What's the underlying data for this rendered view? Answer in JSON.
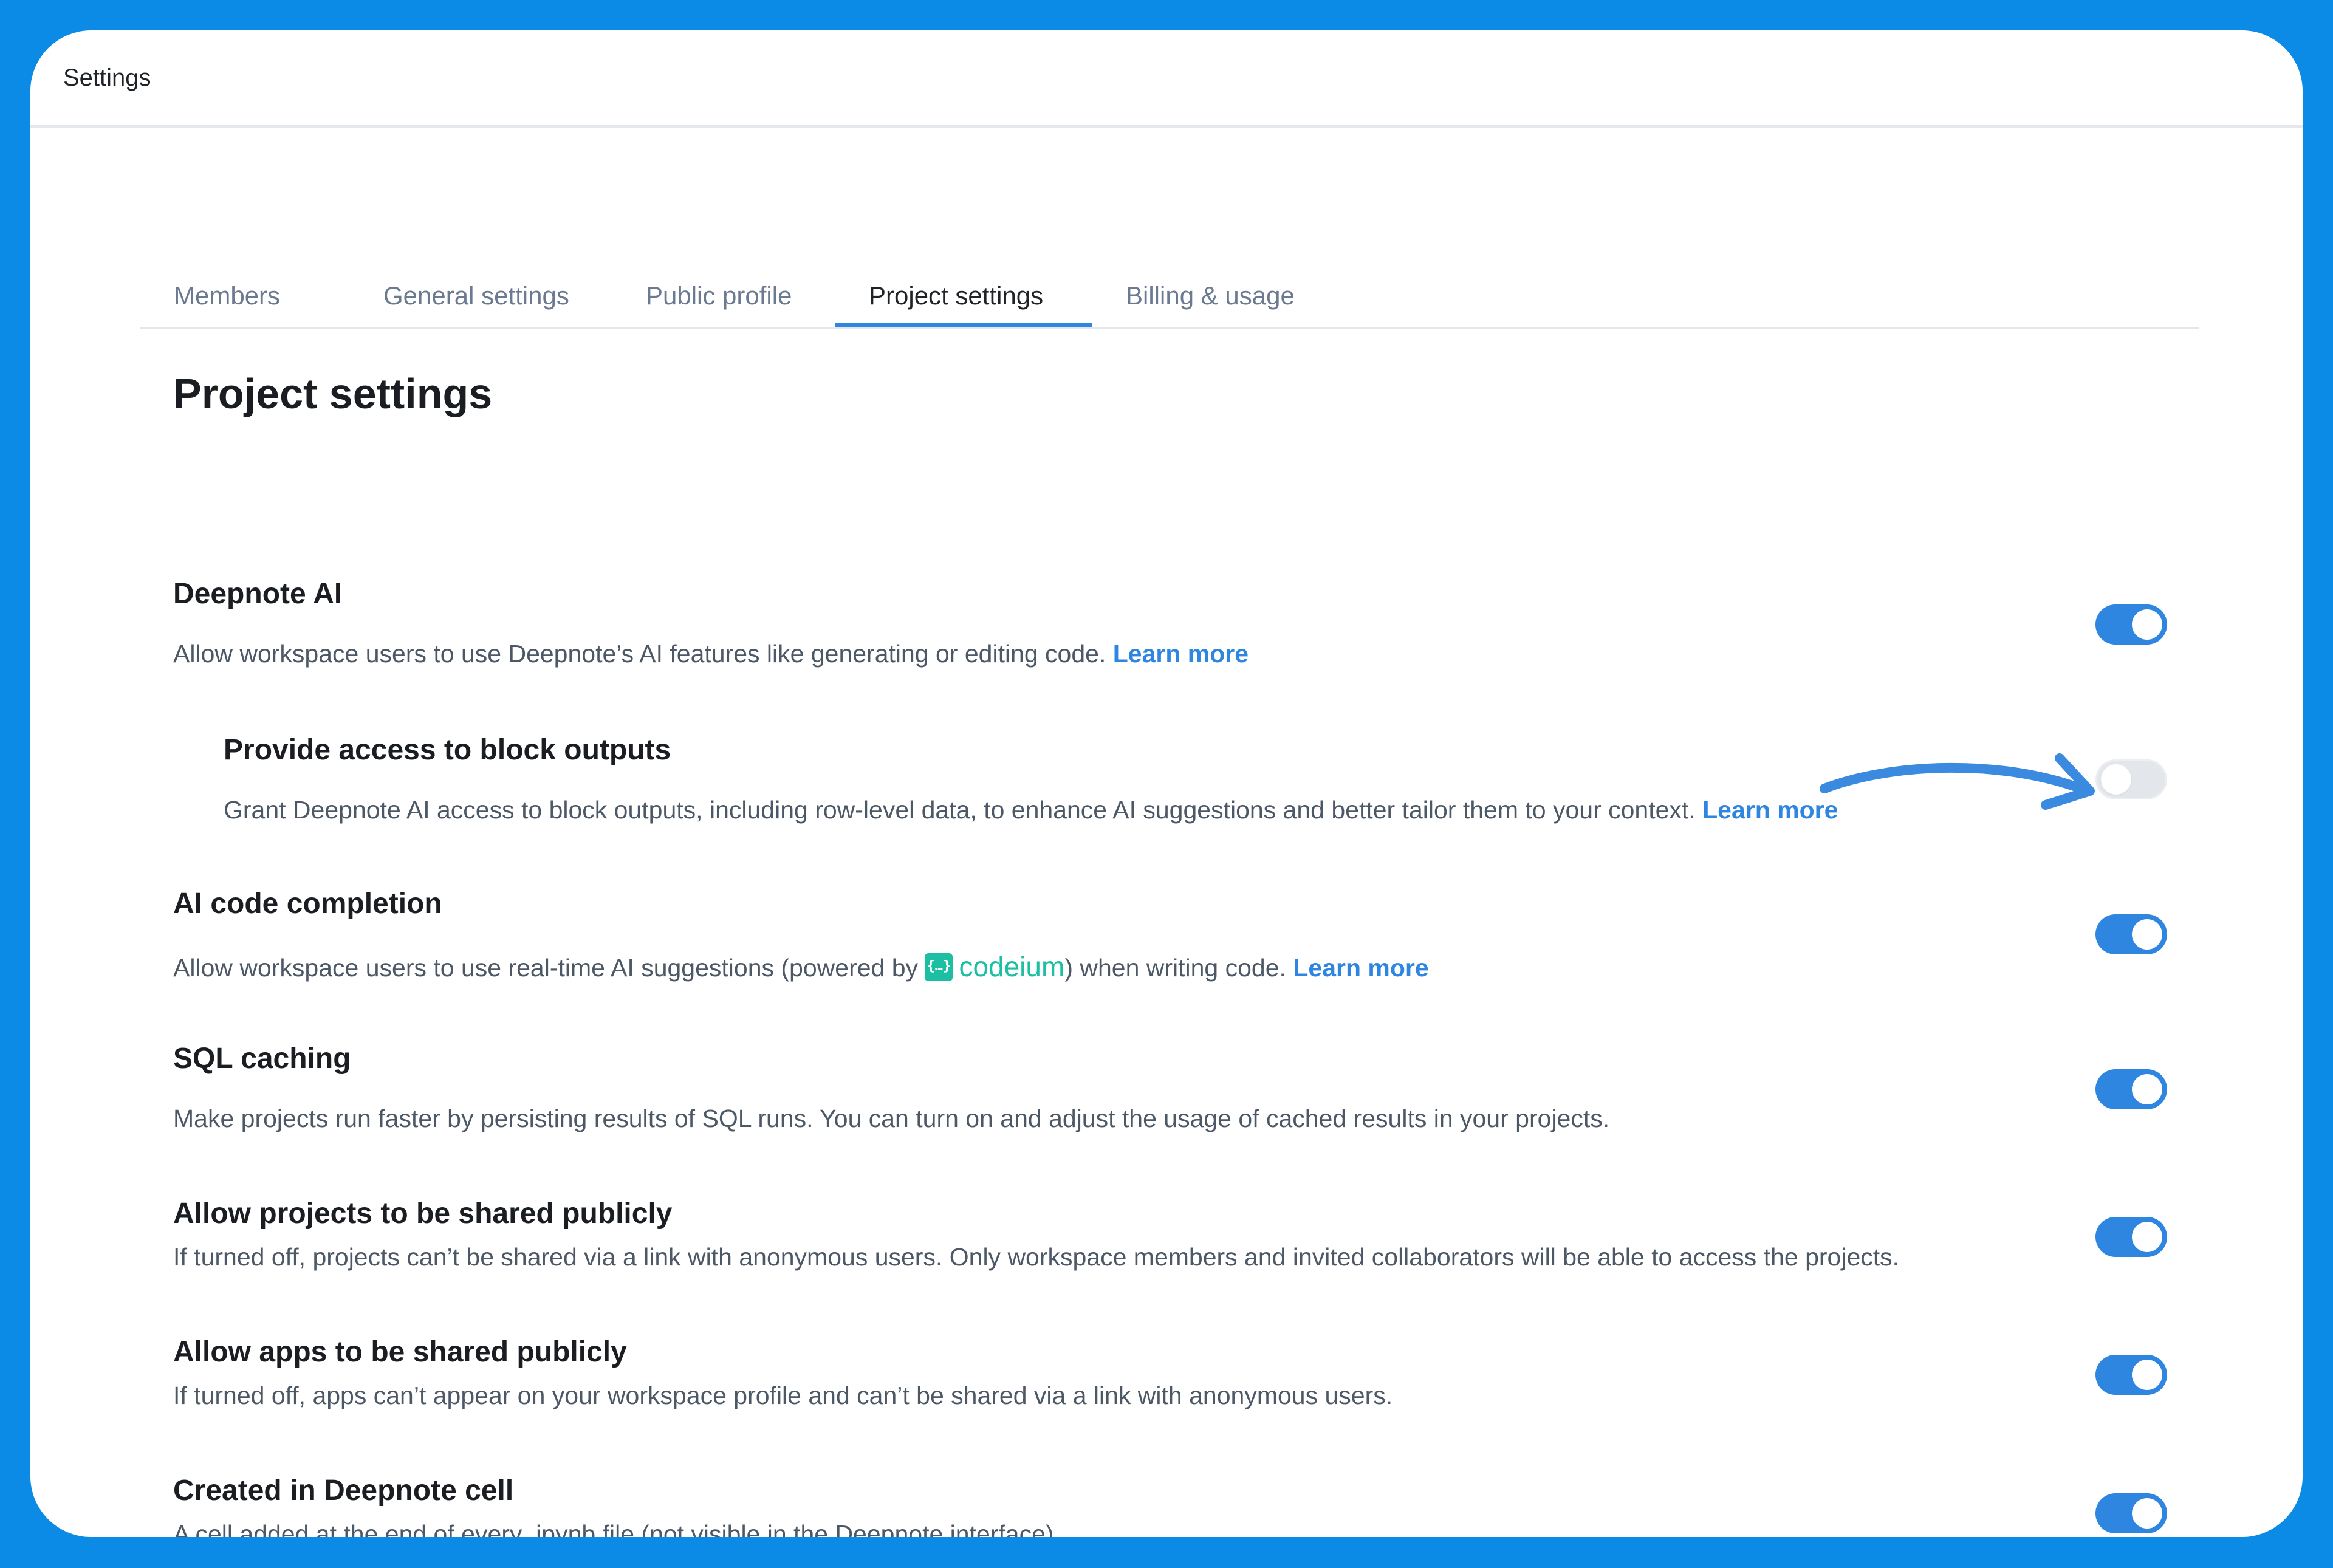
{
  "window": {
    "title": "Settings"
  },
  "tabs": [
    {
      "label": "Members",
      "active": false
    },
    {
      "label": "General settings",
      "active": false
    },
    {
      "label": "Public profile",
      "active": false
    },
    {
      "label": "Project settings",
      "active": true
    },
    {
      "label": "Billing & usage",
      "active": false
    }
  ],
  "page": {
    "title": "Project settings"
  },
  "settings": {
    "deepnote_ai": {
      "title": "Deepnote AI",
      "description": "Allow workspace users to use Deepnote’s AI features like generating or editing code.",
      "link": "Learn more",
      "enabled": true
    },
    "block_outputs": {
      "title": "Provide access to block outputs",
      "description": "Grant Deepnote AI access to block outputs, including row-level data, to enhance AI suggestions and better tailor them to your context.",
      "link": "Learn more",
      "enabled": false
    },
    "code_completion": {
      "title": "AI code completion",
      "description_before": "Allow workspace users to use real-time AI suggestions (powered by",
      "powered_by_logo": "{…}",
      "powered_by": "codeium",
      "description_after": ") when writing code.",
      "link": "Learn more",
      "enabled": true
    },
    "sql_caching": {
      "title": "SQL caching",
      "description": "Make projects run faster by persisting results of SQL runs. You can turn on and adjust the usage of cached results in your projects.",
      "enabled": true
    },
    "share_projects": {
      "title": "Allow projects to be shared publicly",
      "description": "If turned off, projects can’t be shared via a link with anonymous users. Only workspace members and invited collaborators will be able to access the projects.",
      "enabled": true
    },
    "share_apps": {
      "title": "Allow apps to be shared publicly",
      "description": "If turned off, apps can’t appear on your workspace profile and can’t be shared via a link with anonymous users.",
      "enabled": true
    },
    "deepnote_cell": {
      "title": "Created in Deepnote cell",
      "description": "A cell added at the end of every .ipynb file (not visible in the Deepnote interface).",
      "enabled": true
    }
  },
  "colors": {
    "background": "#0b8ae6",
    "accent": "#2f86e0",
    "codeium": "#1cbfa2",
    "toggle_off": "#e3e6ea"
  }
}
